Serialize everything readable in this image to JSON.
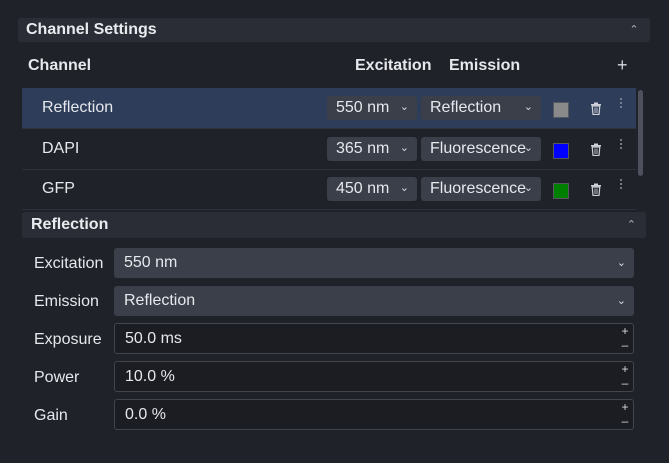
{
  "panel": {
    "title": "Channel Settings",
    "collapse_icon": "chevron-up-icon"
  },
  "columns": {
    "channel": "Channel",
    "excitation": "Excitation",
    "emission": "Emission",
    "add_icon": "plus-icon"
  },
  "channels": [
    {
      "name": "Reflection",
      "excitation": "550 nm",
      "emission": "Reflection",
      "color": "#8a8a8a",
      "selected": true
    },
    {
      "name": "DAPI",
      "excitation": "365 nm",
      "emission": "Fluorescence",
      "color": "#0000ff",
      "selected": false
    },
    {
      "name": "GFP",
      "excitation": "450 nm",
      "emission": "Fluorescence",
      "color": "#008000",
      "selected": false
    }
  ],
  "detail": {
    "title": "Reflection",
    "collapse_icon": "chevron-up-icon",
    "fields": {
      "excitation": {
        "label": "Excitation",
        "value": "550 nm"
      },
      "emission": {
        "label": "Emission",
        "value": "Reflection"
      },
      "exposure": {
        "label": "Exposure",
        "value": "50.0 ms"
      },
      "power": {
        "label": "Power",
        "value": "10.0 %"
      },
      "gain": {
        "label": "Gain",
        "value": "0.0 %"
      }
    }
  },
  "icons": {
    "trash": "trash-icon",
    "kebab": "kebab-menu-icon",
    "chevron": "chevron-down-icon"
  }
}
